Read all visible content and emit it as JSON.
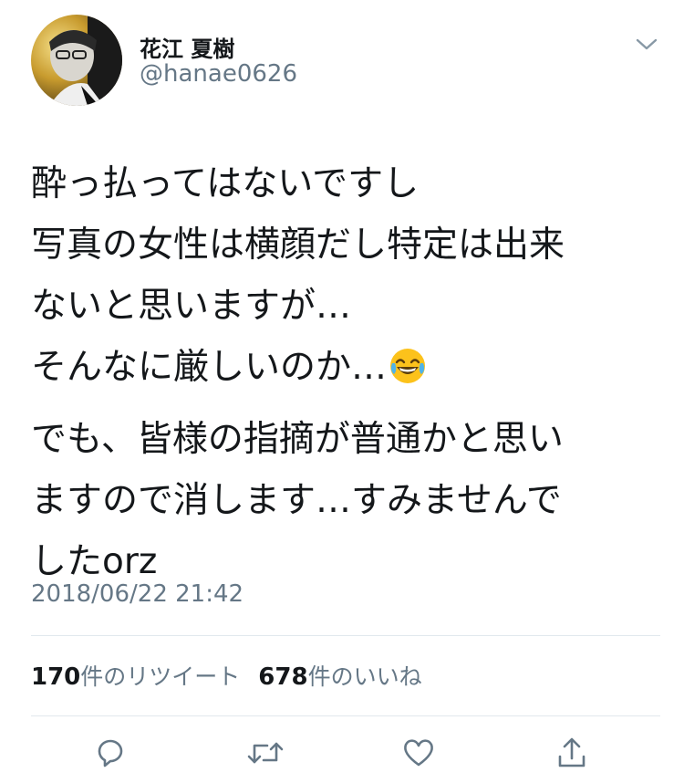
{
  "profile": {
    "display_name": "花江 夏樹",
    "handle": "@hanae0626",
    "avatar_icon": "profile-photo"
  },
  "tweet": {
    "lines_p1": [
      "酔っ払ってはないですし",
      "写真の女性は横顔だし特定は出来",
      "ないと思いますが…",
      "そんなに厳しいのか…"
    ],
    "emoji": "face-with-tears-of-joy",
    "lines_p2": [
      "でも、皆様の指摘が普通かと思い",
      "ますので消します…すみませんで",
      "したorz"
    ],
    "timestamp": "2018/06/22 21:42"
  },
  "stats": {
    "retweets": "170",
    "retweets_label": "件のリツイート",
    "likes": "678",
    "likes_label": "件のいいね"
  },
  "actions": {
    "reply_icon": "reply-icon",
    "retweet_icon": "retweet-icon",
    "like_icon": "heart-icon",
    "share_icon": "share-icon"
  },
  "colors": {
    "text": "#14171a",
    "secondary": "#657786",
    "divider": "#e1e8ed",
    "icon": "#657786"
  }
}
